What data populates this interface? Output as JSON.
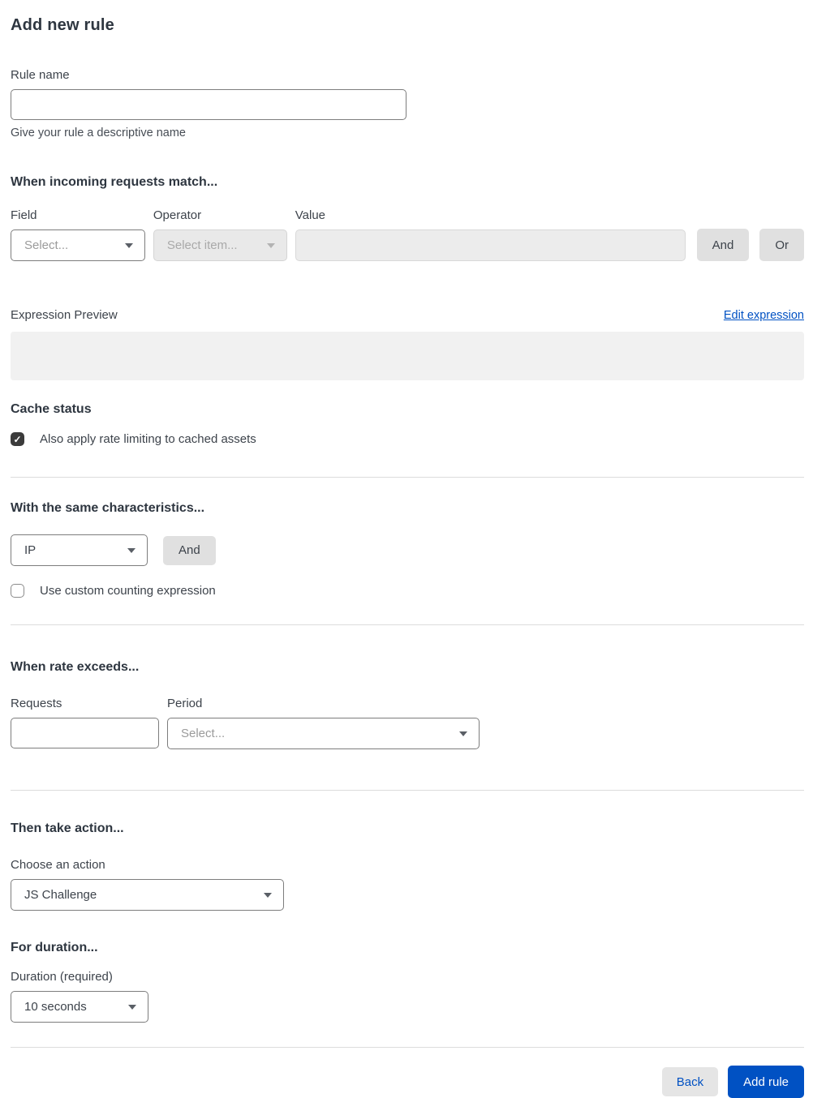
{
  "page": {
    "title": "Add new rule"
  },
  "rule_name": {
    "label": "Rule name",
    "value": "",
    "helper": "Give your rule a descriptive name"
  },
  "match_section": {
    "heading": "When incoming requests match...",
    "field": {
      "label": "Field",
      "value": "Select..."
    },
    "operator": {
      "label": "Operator",
      "value": "Select item..."
    },
    "value": {
      "label": "Value",
      "value": ""
    },
    "and_button": "And",
    "or_button": "Or",
    "expression_preview_label": "Expression Preview",
    "edit_expression_link": "Edit expression",
    "expression_preview_value": ""
  },
  "cache_section": {
    "heading": "Cache status",
    "checkbox_label": "Also apply rate limiting to cached assets",
    "checked": true
  },
  "characteristics_section": {
    "heading": "With the same characteristics...",
    "select_value": "IP",
    "and_button": "And",
    "checkbox_label": "Use custom counting expression",
    "checked": false
  },
  "rate_section": {
    "heading": "When rate exceeds...",
    "requests": {
      "label": "Requests",
      "value": ""
    },
    "period": {
      "label": "Period",
      "value": "Select..."
    }
  },
  "action_section": {
    "heading": "Then take action...",
    "label": "Choose an action",
    "value": "JS Challenge"
  },
  "duration_section": {
    "heading": "For duration...",
    "label": "Duration (required)",
    "value": "10 seconds"
  },
  "footer": {
    "back_label": "Back",
    "add_rule_label": "Add rule"
  },
  "icons": {
    "chevron_down": "chevron-down-icon",
    "checkmark": "✓"
  },
  "colors": {
    "accent_blue": "#0051c3",
    "checkbox_checked": "#3b3b3b",
    "disabled_bg": "#e9e9e9",
    "preview_bg": "#f1f1f1",
    "button_gray": "#e0e0e0"
  }
}
